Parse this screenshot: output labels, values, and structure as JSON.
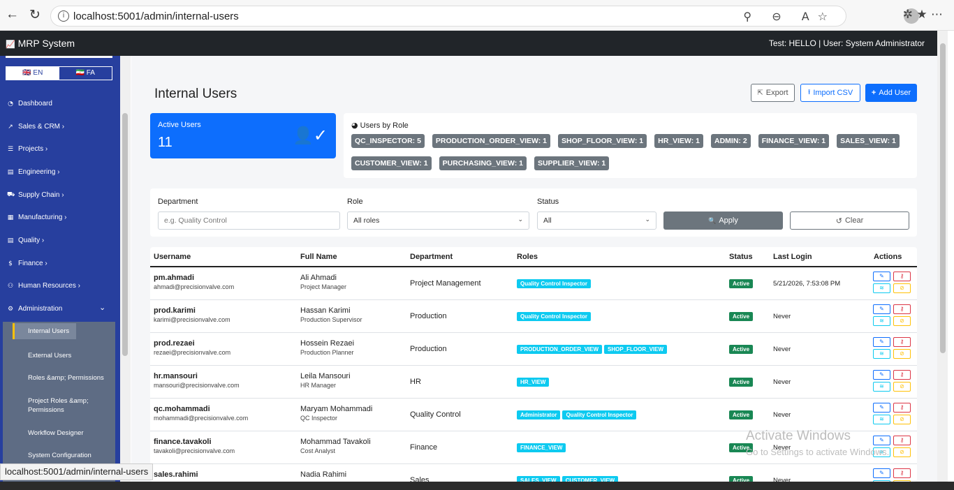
{
  "browser": {
    "url": "localhost:5001/admin/internal-users",
    "status_url": "localhost:5001/admin/internal-users",
    "info_glyph": "i",
    "back_glyph": "←",
    "reload_glyph": "↻",
    "tab_icons": "⚲ ⊖ A☆",
    "right_icons": "✲ ★ ⋯"
  },
  "app": {
    "brand": "MRP System",
    "brand_icon": "📈",
    "topbar_right": "Test: HELLO | User: System Administrator"
  },
  "sidebar": {
    "lang_en": "🇬🇧 EN",
    "lang_fa": "🇮🇷 FA",
    "items": [
      {
        "label": "Dashboard",
        "icon": "◔"
      },
      {
        "label": "Sales & CRM ›",
        "icon": "↗"
      },
      {
        "label": "Projects ›",
        "icon": "☰"
      },
      {
        "label": "Engineering ›",
        "icon": "▤"
      },
      {
        "label": "Supply Chain ›",
        "icon": "⛟"
      },
      {
        "label": "Manufacturing ›",
        "icon": "▦"
      },
      {
        "label": "Quality ›",
        "icon": "▤"
      },
      {
        "label": "Finance ›",
        "icon": "$"
      },
      {
        "label": "Human Resources ›",
        "icon": "⚇"
      },
      {
        "label": "Administration",
        "icon": "⚙",
        "caret": "⌄"
      }
    ],
    "subitems": [
      "Internal Users",
      "External Users",
      "Roles &amp; Permissions",
      "Project Roles &amp;",
      "Permissions",
      "Workflow Designer",
      "System Configuration"
    ]
  },
  "page": {
    "title": "Internal Users",
    "export_label": "Export",
    "import_label": "Import CSV",
    "add_label": "Add User",
    "export_icon": "⇱",
    "import_icon": "⭱",
    "add_icon": "+",
    "active_users_label": "Active Users",
    "active_users_value": "11",
    "active_users_icon": "👤✓",
    "roles_header": "Users by Role",
    "roles_header_icon": "◕",
    "role_counts": [
      "QC_INSPECTOR: 5",
      "PRODUCTION_ORDER_VIEW: 1",
      "SHOP_FLOOR_VIEW: 1",
      "HR_VIEW: 1",
      "ADMIN: 2",
      "FINANCE_VIEW: 1",
      "SALES_VIEW: 1",
      "CUSTOMER_VIEW: 1",
      "PURCHASING_VIEW: 1",
      "SUPPLIER_VIEW: 1"
    ]
  },
  "filters": {
    "department_label": "Department",
    "department_placeholder": "e.g. Quality Control",
    "role_label": "Role",
    "role_value": "All roles",
    "status_label": "Status",
    "status_value": "All",
    "apply_label": "Apply",
    "apply_icon": "🔍",
    "clear_label": "Clear",
    "clear_icon": "↺",
    "caret": "⌄"
  },
  "table": {
    "headers": [
      "Username",
      "Full Name",
      "Department",
      "Roles",
      "Status",
      "Last Login",
      "Actions"
    ],
    "action_glyphs": {
      "edit": "✎",
      "key": "⚷",
      "wifi": "≋",
      "ban": "⊘"
    },
    "rows": [
      {
        "username": "pm.ahmadi",
        "email": "ahmadi@precisionvalve.com",
        "full_name": "Ali Ahmadi",
        "title": "Project Manager",
        "department": "Project Management",
        "roles": [
          "Quality Control Inspector"
        ],
        "status": "Active",
        "last_login": "5/21/2026, 7:53:08 PM"
      },
      {
        "username": "prod.karimi",
        "email": "karimi@precisionvalve.com",
        "full_name": "Hassan Karimi",
        "title": "Production Supervisor",
        "department": "Production",
        "roles": [
          "Quality Control Inspector"
        ],
        "status": "Active",
        "last_login": "Never"
      },
      {
        "username": "prod.rezaei",
        "email": "rezaei@precisionvalve.com",
        "full_name": "Hossein Rezaei",
        "title": "Production Planner",
        "department": "Production",
        "roles": [
          "PRODUCTION_ORDER_VIEW",
          "SHOP_FLOOR_VIEW"
        ],
        "status": "Active",
        "last_login": "Never"
      },
      {
        "username": "hr.mansouri",
        "email": "mansouri@precisionvalve.com",
        "full_name": "Leila Mansouri",
        "title": "HR Manager",
        "department": "HR",
        "roles": [
          "HR_VIEW"
        ],
        "status": "Active",
        "last_login": "Never"
      },
      {
        "username": "qc.mohammadi",
        "email": "mohammadi@precisionvalve.com",
        "full_name": "Maryam Mohammadi",
        "title": "QC Inspector",
        "department": "Quality Control",
        "roles": [
          "Administrator",
          "Quality Control Inspector"
        ],
        "status": "Active",
        "last_login": "Never"
      },
      {
        "username": "finance.tavakoli",
        "email": "tavakoli@precisionvalve.com",
        "full_name": "Mohammad Tavakoli",
        "title": "Cost Analyst",
        "department": "Finance",
        "roles": [
          "FINANCE_VIEW"
        ],
        "status": "Active",
        "last_login": "Never"
      },
      {
        "username": "sales.rahimi",
        "email": "",
        "full_name": "Nadia Rahimi",
        "title": "",
        "department": "Sales",
        "roles": [
          "SALES_VIEW",
          "CUSTOMER_VIEW"
        ],
        "status": "Active",
        "last_login": "Never"
      }
    ]
  },
  "watermark": {
    "line1": "Activate Windows",
    "line2": "Go to Settings to activate Windows."
  }
}
